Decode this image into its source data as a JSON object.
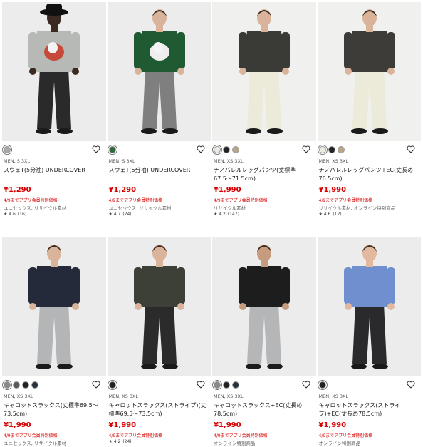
{
  "products": [
    {
      "gender_size": "MEN, S 3XL",
      "name": "スウェT(5分袖) UNDERCOVER",
      "price": "¥1,290",
      "promo": "4/9までアプリ会員特別価格",
      "tags": "ユニセックス, リサイクル素材",
      "rating": "★ 4.6",
      "reviews": "(16)",
      "swatches": [
        "#a8aaa8"
      ],
      "bg": "#ececec",
      "top": "#b7b9b6",
      "bottom": "#2a2a2a",
      "hat": true,
      "graphic": "#c54a3a",
      "skin": "#3b2a22"
    },
    {
      "gender_size": "MEN, S 3XL",
      "name": "スウェT(5分袖) UNDERCOVER",
      "price": "¥1,290",
      "promo": "4/9までアプリ会員特別価格",
      "tags": "ユニセックス, リサイクル素材",
      "rating": "★ 4.7",
      "reviews": "(24)",
      "swatches": [
        "#2f6a3c"
      ],
      "bg": "#ececec",
      "top": "#1f5a32",
      "bottom": "#7f7f7f",
      "hat": false,
      "graphic": "#eeeeee",
      "skin": "#d9b49a"
    },
    {
      "gender_size": "MEN, XS 3XL",
      "name": "チノバレルレッグパンツ(丈標準67.5〜71.5cm)",
      "price": "¥1,990",
      "promo": "4/9までアプリ会員特別価格",
      "tags": "リサイクル素材",
      "rating": "★ 4.2",
      "reviews": "(147)",
      "swatches": [
        "#ecebe4",
        "#222222",
        "#b8a58a"
      ],
      "bg": "#f0f0ef",
      "top": "#3a3a36",
      "bottom": "#ecead9",
      "hat": false,
      "graphic": "",
      "skin": "#d9b49a"
    },
    {
      "gender_size": "MEN, XS 3XL",
      "name": "チノバレルレッグパンツ+EC(丈長め76.5cm)",
      "price": "¥1,990",
      "promo": "4/9までアプリ会員特別価格",
      "tags": "リサイクル素材, オンライン特別商品",
      "rating": "★ 4.6",
      "reviews": "(12)",
      "swatches": [
        "#ecebe4",
        "#222222",
        "#b8a58a"
      ],
      "bg": "#f0f0ef",
      "top": "#3d3c38",
      "bottom": "#ecead9",
      "hat": false,
      "graphic": "",
      "skin": "#d9b49a"
    },
    {
      "gender_size": "MEN, XS 3XL",
      "name": "キャロットスラックス(丈標準69.5〜73.5cm)",
      "price": "¥1,990",
      "promo": "4/9までアプリ会員特別価格",
      "tags": "ユニセックス, リサイクル素材",
      "rating": "",
      "reviews": "",
      "swatches": [
        "#8a8a8a",
        "#5a5a5a",
        "#222222",
        "#2a3040"
      ],
      "bg": "#ececec",
      "top": "#242a3a",
      "bottom": "#b3b5b6",
      "hat": false,
      "graphic": "",
      "skin": "#d9b49a"
    },
    {
      "gender_size": "MEN, XS 3XL",
      "name": "キャロットスラックス(ストライプ)(丈標準69.5〜73.5cm)",
      "price": "¥1,990",
      "promo": "4/9までアプリ会員特別価格",
      "tags": "",
      "rating": "★ 4.2",
      "reviews": "(24)",
      "swatches": [
        "#222222"
      ],
      "bg": "#ececec",
      "top": "#3c4036",
      "bottom": "#2b2b2b",
      "hat": false,
      "graphic": "",
      "skin": "#d9b49a"
    },
    {
      "gender_size": "MEN, XS 3XL",
      "name": "キャロットスラックス+EC(丈長め78.5cm)",
      "price": "¥1,990",
      "promo": "4/9までアプリ会員特別価格",
      "tags": "オンライン特別商品",
      "rating": "",
      "reviews": "",
      "swatches": [
        "#8a8a8a",
        "#222222",
        "#2a3040"
      ],
      "bg": "#ececec",
      "top": "#1d1d1d",
      "bottom": "#b5b6b7",
      "hat": false,
      "graphic": "",
      "skin": "#c79c7e"
    },
    {
      "gender_size": "MEN, XS 3XL",
      "name": "キャロットスラックス(ストライプ)+EC(丈長め78.5cm)",
      "price": "¥1,990",
      "promo": "4/9までアプリ会員特別価格",
      "tags": "オンライン特別商品",
      "rating": "",
      "reviews": "",
      "swatches": [
        "#222222"
      ],
      "bg": "#ececec",
      "top": "#6f8fcf",
      "bottom": "#2a2a2c",
      "hat": false,
      "graphic": "",
      "skin": "#e2b99f"
    }
  ]
}
